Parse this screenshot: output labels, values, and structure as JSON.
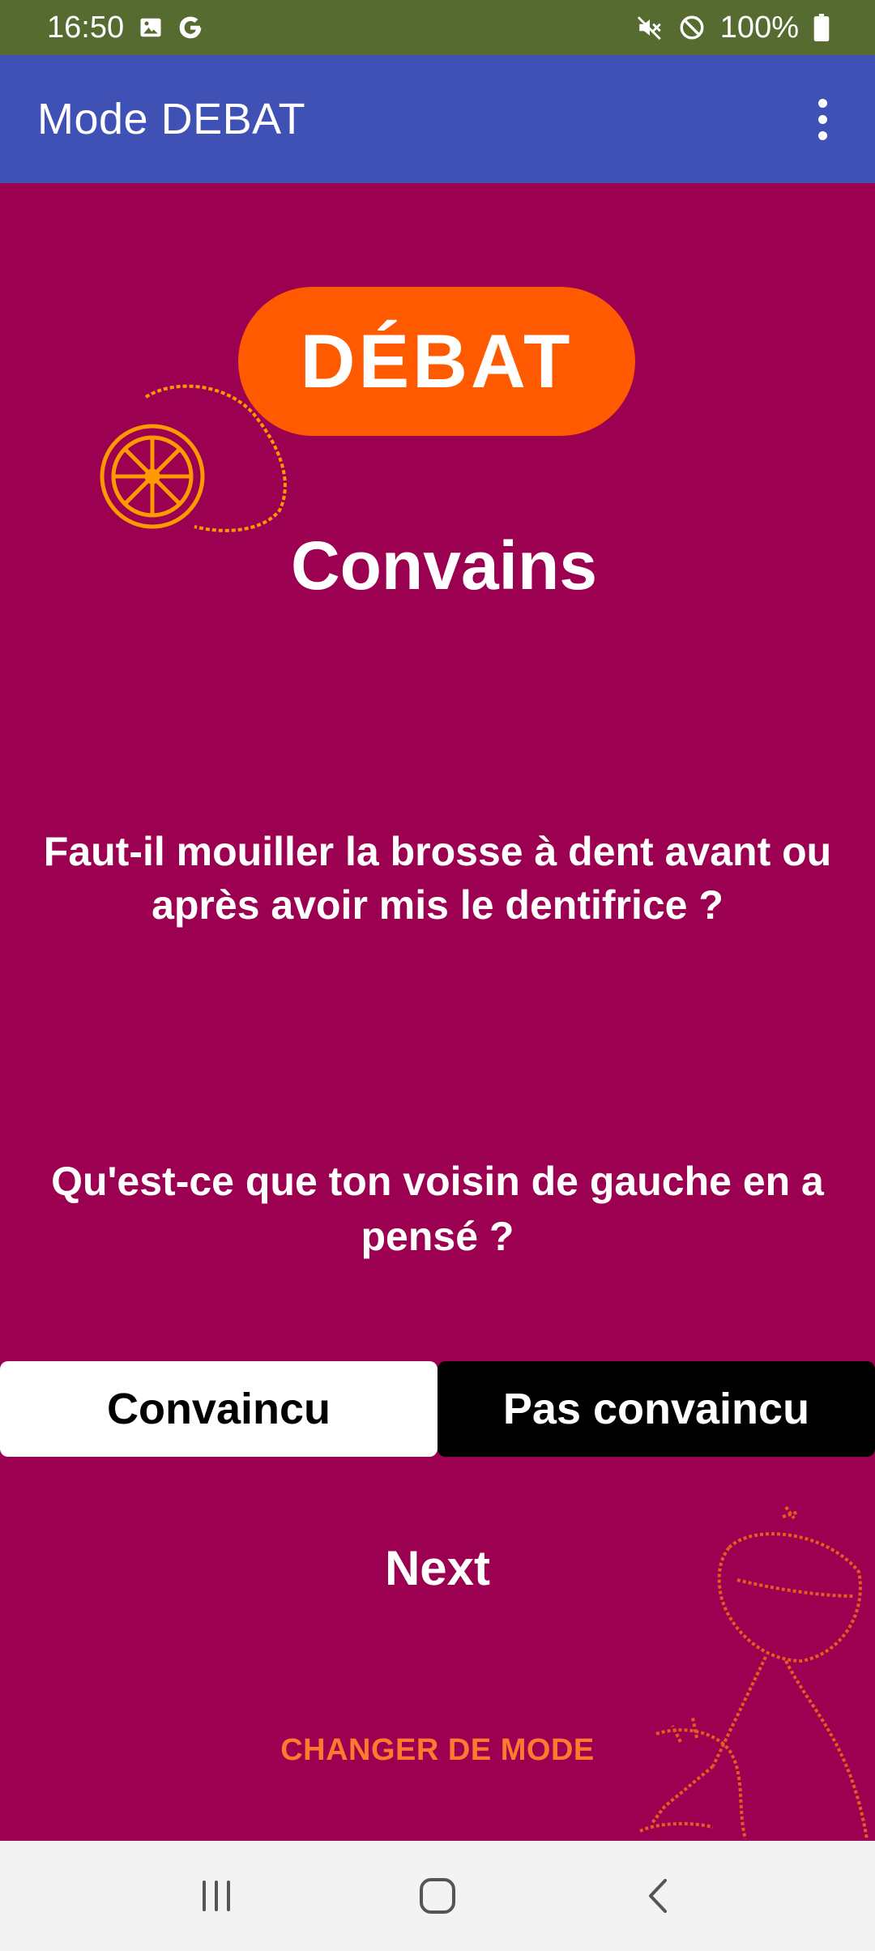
{
  "status_bar": {
    "time": "16:50",
    "left_icons": [
      "image-icon",
      "google-icon"
    ],
    "right_icons": [
      "mute-icon",
      "do-not-disturb-icon",
      "battery-icon"
    ],
    "battery": "100%"
  },
  "app_bar": {
    "title": "Mode DEBAT",
    "menu_icon": "more-vert-icon"
  },
  "logo": {
    "text": "DÉBAT",
    "pill_color": "#ff5a00",
    "illustration": "lemon-icon"
  },
  "mode_title": "Convains",
  "question": "Faut-il mouiller la brosse à dent avant ou après avoir mis le dentifrice ?",
  "prompt": "Qu'est-ce que ton voisin de gauche en a pensé ?",
  "choices": {
    "convinced": "Convaincu",
    "not_convinced": "Pas convaincu"
  },
  "next_label": "Next",
  "change_mode_label": "CHANGER DE MODE",
  "colors": {
    "background": "#9c0051",
    "app_bar": "#3f51b5",
    "status_bar": "#556b2f",
    "accent": "#ff7a2e"
  },
  "nav_bar": {
    "icons": [
      "recents-icon",
      "home-icon",
      "back-icon"
    ]
  }
}
